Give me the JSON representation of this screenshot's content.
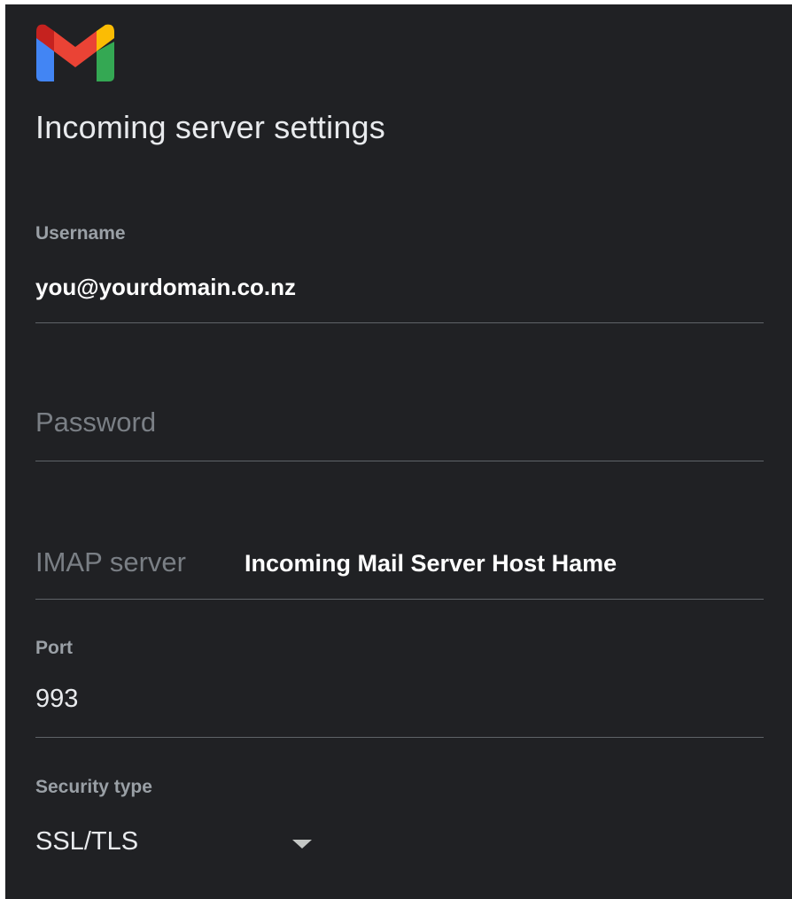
{
  "header": {
    "logo_icon": "gmail-icon",
    "title": "Incoming server settings"
  },
  "username": {
    "label": "Username",
    "value": "you@yourdomain.co.nz"
  },
  "password": {
    "placeholder": "Password",
    "value": ""
  },
  "imap_server": {
    "placeholder": "IMAP server",
    "annotation": "Incoming Mail Server Host Hame"
  },
  "port": {
    "label": "Port",
    "value": "993"
  },
  "security_type": {
    "label": "Security type",
    "value": "SSL/TLS",
    "dropdown_icon": "dropdown-arrow-icon"
  },
  "colors": {
    "background": "#202124",
    "text_primary": "#e8eaed",
    "text_label": "#9aa0a6",
    "divider": "#5f6368",
    "gmail_red": "#ea4335",
    "gmail_blue": "#4285f4",
    "gmail_green": "#34a853",
    "gmail_yellow": "#fbbc04",
    "gmail_dark_red": "#c5221f"
  }
}
